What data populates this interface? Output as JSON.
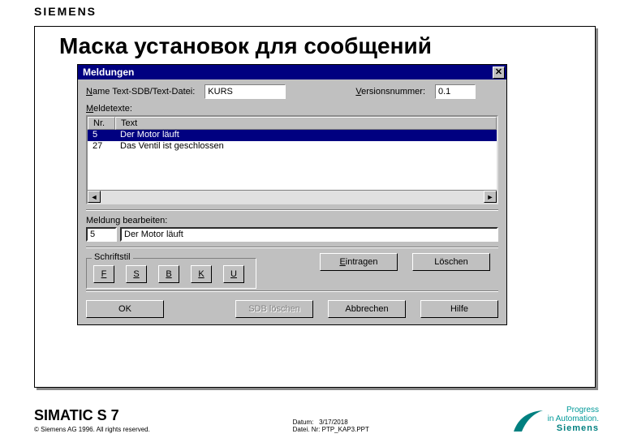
{
  "brand": "SIEMENS",
  "slide_title": "Маска установок для сообщений",
  "dialog": {
    "title": "Meldungen",
    "name_label": "Name Text-SDB/Text-Datei:",
    "name_value": "KURS",
    "version_label": "Versionsnummer:",
    "version_value": "0.1",
    "meldetexte_label": "Meldetexte:",
    "list": {
      "col_nr": "Nr.",
      "col_text": "Text",
      "rows": [
        {
          "nr": "5",
          "text": "Der Motor läuft",
          "selected": true
        },
        {
          "nr": "27",
          "text": "Das Ventil ist geschlossen",
          "selected": false
        }
      ]
    },
    "edit_label": "Meldung bearbeiten:",
    "edit_nr": "5",
    "edit_text": "Der Motor läuft",
    "group_title": "Schriftstil",
    "style_buttons": {
      "f": "F",
      "s": "S",
      "b": "B",
      "k": "K",
      "u": "U"
    },
    "btn_eintragen": "Eintragen",
    "btn_loeschen": "Löschen",
    "btn_ok": "OK",
    "btn_sdb": "SDB löschen",
    "btn_abbrechen": "Abbrechen",
    "btn_hilfe": "Hilfe"
  },
  "footer": {
    "product": "SIMATIC S 7",
    "copyright": "© Siemens AG 1996. All rights reserved.",
    "datum_label": "Datum:",
    "datum_value": "3/17/2018",
    "datei_label": "Datei. Nr:",
    "datei_value": "PTP_KAP3.PPT",
    "tag1": "Progress",
    "tag2": "in Automation.",
    "tag3": "Siemens"
  }
}
